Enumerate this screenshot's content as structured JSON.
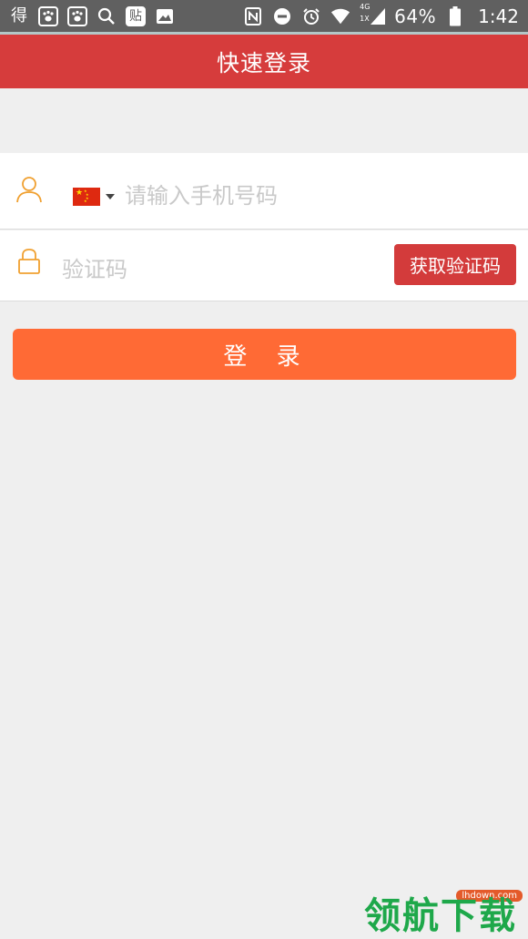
{
  "status_bar": {
    "icons_left": [
      "de-icon",
      "paw-icon",
      "paw-icon",
      "search-icon",
      "tieba-icon",
      "image-icon"
    ],
    "tieba_label": "贴",
    "de_label": "得",
    "network_label": "4G",
    "network_sub": "1X",
    "battery": "64%",
    "time": "1:42"
  },
  "header": {
    "title": "快速登录"
  },
  "form": {
    "phone_placeholder": "请输入手机号码",
    "code_placeholder": "验证码",
    "get_code_label": "获取验证码",
    "login_label": "登 录",
    "country_flag": "china-flag"
  },
  "colors": {
    "header": "#d63c3c",
    "accent_orange": "#ff6a35",
    "icon_orange": "#f0a030",
    "get_code_btn": "#d33b3b"
  },
  "watermark": {
    "text": "领航下载",
    "url": "lhdown.com"
  }
}
